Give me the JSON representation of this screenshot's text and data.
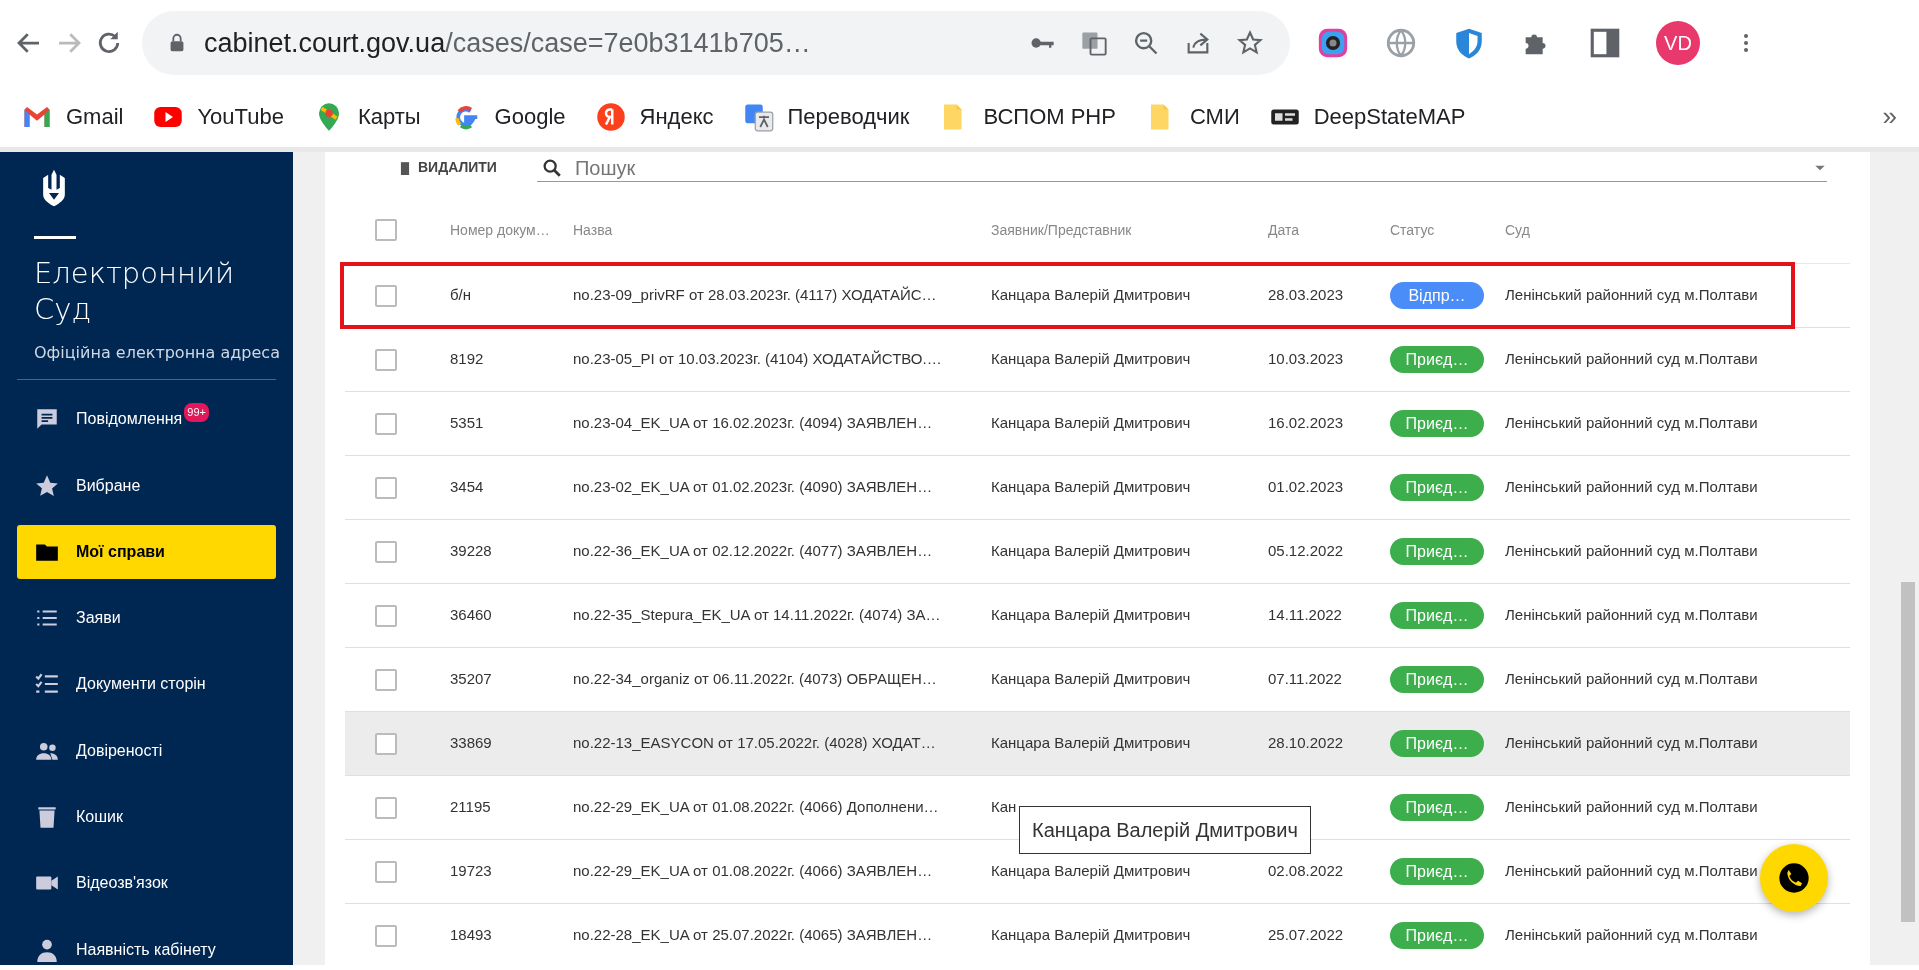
{
  "browser": {
    "url_host": "cabinet.court.gov.ua",
    "url_path": "/cases/case=7e0b3141b705…",
    "profile_initials": "VD",
    "overflow": "»",
    "bookmarks": [
      {
        "label": "Gmail",
        "kind": "gmail"
      },
      {
        "label": "YouTube",
        "kind": "youtube"
      },
      {
        "label": "Карты",
        "kind": "maps"
      },
      {
        "label": "Google",
        "kind": "google"
      },
      {
        "label": "Яндекс",
        "kind": "yandex"
      },
      {
        "label": "Переводчик",
        "kind": "translate"
      },
      {
        "label": "ВСПОМ PHP",
        "kind": "folder"
      },
      {
        "label": "СМИ",
        "kind": "folder"
      },
      {
        "label": "DeepStateMAP",
        "kind": "deepstate"
      }
    ]
  },
  "sidebar": {
    "title": "Електронний Суд",
    "subtitle": "Офіційна електронна адреса",
    "items": [
      {
        "label": "Повідомлення",
        "kind": "chat",
        "selected": false,
        "badge": "99+"
      },
      {
        "label": "Вибране",
        "kind": "star",
        "selected": false
      },
      {
        "label": "Мої справи",
        "kind": "folder",
        "selected": true
      },
      {
        "label": "Заяви",
        "kind": "list",
        "selected": false
      },
      {
        "label": "Документи сторін",
        "kind": "checklist",
        "selected": false
      },
      {
        "label": "Довіреності",
        "kind": "people",
        "selected": false
      },
      {
        "label": "Кошик",
        "kind": "trash",
        "selected": false
      },
      {
        "label": "Відеозв'язок",
        "kind": "video",
        "selected": false
      },
      {
        "label": "Наявність кабінету",
        "kind": "person",
        "selected": false
      }
    ]
  },
  "toolbar": {
    "delete_label": "ВИДАЛИТИ",
    "search_placeholder": "Пошук"
  },
  "table": {
    "select_all_checked": false,
    "columns": [
      "Номер докум…",
      "Назва",
      "Заявник/Представник",
      "Дата",
      "Статус",
      "Суд"
    ],
    "rows": [
      {
        "checked": false,
        "highlighted": true,
        "hovered": false,
        "number": "б/н",
        "name": "no.23-09_privRF от 28.03.2023г. (4117) ХОДАТАЙС…",
        "applicant": "Канцара Валерій Дмитрович",
        "date": "28.03.2023",
        "status": {
          "label": "Відпр…",
          "color": "#4b8df8"
        },
        "court": "Ленінський районний суд м.Полтави"
      },
      {
        "checked": false,
        "highlighted": false,
        "hovered": false,
        "number": "8192",
        "name": "no.23-05_PI от 10.03.2023г. (4104) ХОДАТАЙСТВО.…",
        "applicant": "Канцара Валерій Дмитрович",
        "date": "10.03.2023",
        "status": {
          "label": "Приєд…",
          "color": "#3cae4b"
        },
        "court": "Ленінський районний суд м.Полтави"
      },
      {
        "checked": false,
        "highlighted": false,
        "hovered": false,
        "number": "5351",
        "name": "no.23-04_EK_UA от 16.02.2023г. (4094) ЗАЯВЛЕН…",
        "applicant": "Канцара Валерій Дмитрович",
        "date": "16.02.2023",
        "status": {
          "label": "Приєд…",
          "color": "#3cae4b"
        },
        "court": "Ленінський районний суд м.Полтави"
      },
      {
        "checked": false,
        "highlighted": false,
        "hovered": false,
        "number": "3454",
        "name": "no.23-02_EK_UA от 01.02.2023г. (4090) ЗАЯВЛЕН…",
        "applicant": "Канцара Валерій Дмитрович",
        "date": "01.02.2023",
        "status": {
          "label": "Приєд…",
          "color": "#3cae4b"
        },
        "court": "Ленінський районний суд м.Полтави"
      },
      {
        "checked": false,
        "highlighted": false,
        "hovered": false,
        "number": "39228",
        "name": "no.22-36_EK_UA от 02.12.2022г. (4077) ЗАЯВЛЕН…",
        "applicant": "Канцара Валерій Дмитрович",
        "date": "05.12.2022",
        "status": {
          "label": "Приєд…",
          "color": "#3cae4b"
        },
        "court": "Ленінський районний суд м.Полтави"
      },
      {
        "checked": false,
        "highlighted": false,
        "hovered": false,
        "number": "36460",
        "name": "no.22-35_Stepura_EK_UA от 14.11.2022г. (4074) ЗА…",
        "applicant": "Канцара Валерій Дмитрович",
        "date": "14.11.2022",
        "status": {
          "label": "Приєд…",
          "color": "#3cae4b"
        },
        "court": "Ленінський районний суд м.Полтави"
      },
      {
        "checked": false,
        "highlighted": false,
        "hovered": false,
        "number": "35207",
        "name": "no.22-34_organiz от 06.11.2022г. (4073) ОБРАЩЕН…",
        "applicant": "Канцара Валерій Дмитрович",
        "date": "07.11.2022",
        "status": {
          "label": "Приєд…",
          "color": "#3cae4b"
        },
        "court": "Ленінський районний суд м.Полтави"
      },
      {
        "checked": false,
        "highlighted": false,
        "hovered": true,
        "number": "33869",
        "name": "no.22-13_EASYCON от 17.05.2022г. (4028) ХОДАТ…",
        "applicant": "Канцара Валерій Дмитрович",
        "date": "28.10.2022",
        "status": {
          "label": "Приєд…",
          "color": "#3cae4b"
        },
        "court": "Ленінський районний суд м.Полтави"
      },
      {
        "checked": false,
        "highlighted": false,
        "hovered": false,
        "number": "21195",
        "name": "no.22-29_EK_UA от 01.08.2022г. (4066) Дополнени…",
        "applicant": "Кан",
        "status": {
          "label": "Приєд…",
          "color": "#3cae4b"
        },
        "court": "Ленінський районний суд м.Полтави",
        "tooltip": "Канцара Валерій Дмитрович"
      },
      {
        "checked": false,
        "highlighted": false,
        "hovered": false,
        "number": "19723",
        "name": "no.22-29_EK_UA от 01.08.2022г. (4066) ЗАЯВЛЕН…",
        "applicant": "Канцара Валерій Дмитрович",
        "date": "02.08.2022",
        "status": {
          "label": "Приєд…",
          "color": "#3cae4b"
        },
        "court": "Ленінський районний суд м.Полтави"
      },
      {
        "checked": false,
        "highlighted": false,
        "hovered": false,
        "number": "18493",
        "name": "no.22-28_EK_UA от 25.07.2022г. (4065) ЗАЯВЛЕН…",
        "applicant": "Канцара Валерій Дмитрович",
        "date": "25.07.2022",
        "status": {
          "label": "Приєд…",
          "color": "#3cae4b"
        },
        "court": "Ленінський районний суд м.Полтави"
      }
    ]
  }
}
